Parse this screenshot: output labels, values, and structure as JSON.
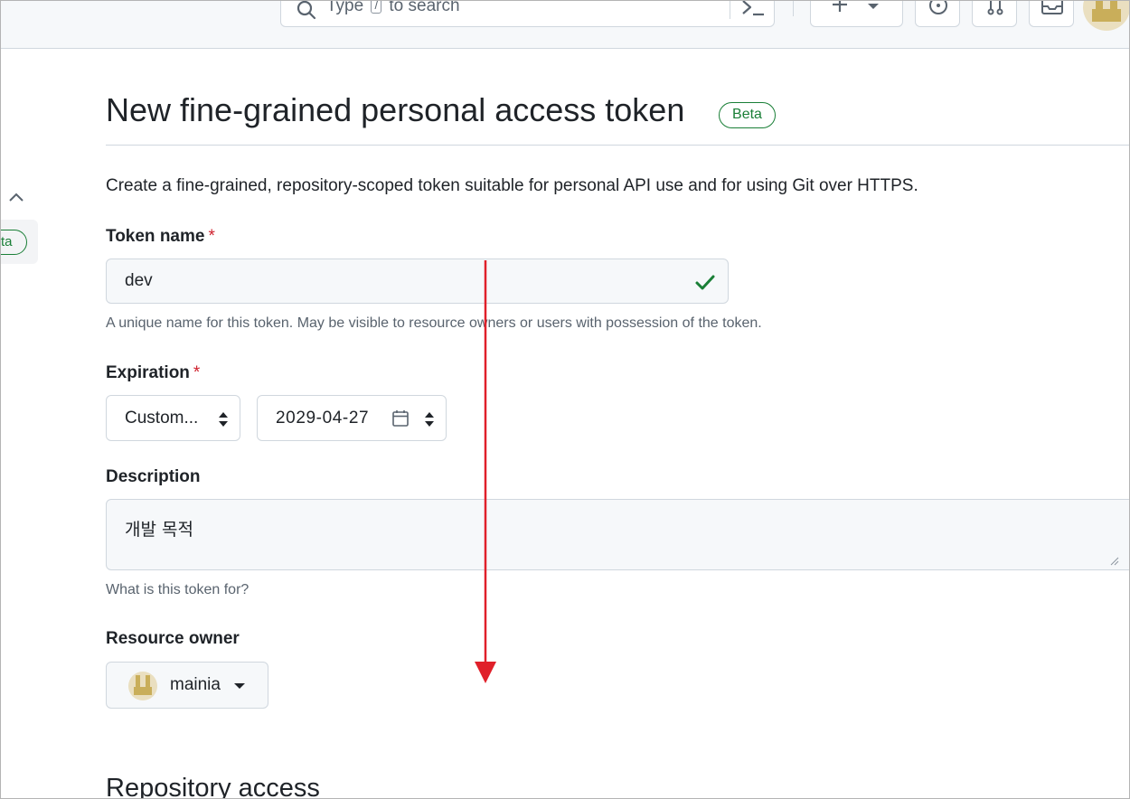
{
  "header": {
    "search": {
      "text_before": "Type",
      "key": "/",
      "text_after": "to search"
    },
    "buttons": [
      "plus-icon",
      "issues-icon",
      "pull-requests-icon",
      "inbox-icon"
    ]
  },
  "sidebar": {
    "badge": "ta"
  },
  "page": {
    "title": "New fine-grained personal access token",
    "badge": "Beta",
    "intro": "Create a fine-grained, repository-scoped token suitable for personal API use and for using Git over HTTPS."
  },
  "form": {
    "token_name": {
      "label": "Token name",
      "required_mark": "*",
      "value": "dev",
      "hint": "A unique name for this token. May be visible to resource owners or users with possession of the token."
    },
    "expiration": {
      "label": "Expiration",
      "required_mark": "*",
      "select_value": "Custom...",
      "date_value": "2029-04-27"
    },
    "description": {
      "label": "Description",
      "value": "개발 목적",
      "hint": "What is this token for?"
    },
    "resource_owner": {
      "label": "Resource owner",
      "value": "mainia"
    }
  },
  "sections": {
    "repository_access": "Repository access"
  },
  "colors": {
    "success": "#1a7f37",
    "required": "#cf222e",
    "annotation_arrow": "#e0202a",
    "border": "#d0d7de",
    "input_bg": "#f6f8fa"
  }
}
